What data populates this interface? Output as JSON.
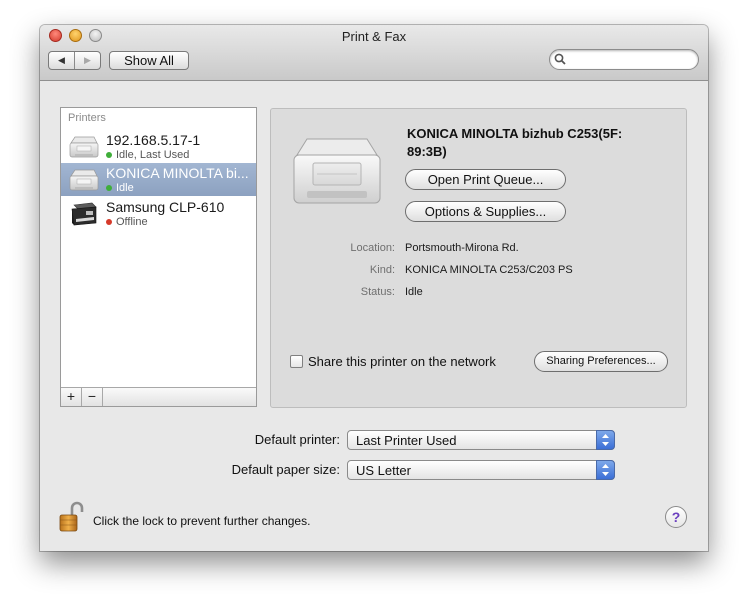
{
  "window": {
    "title": "Print & Fax"
  },
  "toolbar": {
    "back_icon": "◀",
    "forward_icon": "▶",
    "show_all_label": "Show All",
    "search": {
      "value": "",
      "placeholder": ""
    }
  },
  "printers_list": {
    "header": "Printers",
    "items": [
      {
        "name": "192.168.5.17-1",
        "status": "Idle, Last Used",
        "status_color": "#3fae3a",
        "selected": false
      },
      {
        "name": "KONICA MINOLTA bizhub C253(5F:89:3B)",
        "name_display": "KONICA MINOLTA bi...",
        "status": "Idle",
        "status_color": "#3fae3a",
        "selected": true
      },
      {
        "name": "Samsung CLP-610",
        "status": "Offline",
        "status_color": "#d63a2a",
        "selected": false
      }
    ],
    "add_label": "+",
    "remove_label": "−"
  },
  "details": {
    "printer_name": "KONICA MINOLTA bizhub C253(5F:89:3B)",
    "printer_name_line1": "KONICA MINOLTA bizhub C253(5F:",
    "printer_name_line2": "89:3B)",
    "open_queue_label": "Open Print Queue...",
    "options_label": "Options & Supplies...",
    "location_label": "Location:",
    "location_value": "Portsmouth-Mirona Rd.",
    "kind_label": "Kind:",
    "kind_value": "KONICA MINOLTA C253/C203 PS",
    "status_label": "Status:",
    "status_value": "Idle",
    "share_label": "Share this printer on the network",
    "share_checked": false,
    "sharing_prefs_label": "Sharing Preferences..."
  },
  "defaults": {
    "printer_label": "Default printer:",
    "printer_value": "Last Printer Used",
    "paper_label": "Default paper size:",
    "paper_value": "US Letter"
  },
  "footer": {
    "lock_text": "Click the lock to prevent further changes.",
    "help_label": "?"
  },
  "colors": {
    "selection": "#8ca1c0",
    "accent_blue": "#3c6fd6",
    "help_purple": "#6b3fbf"
  }
}
